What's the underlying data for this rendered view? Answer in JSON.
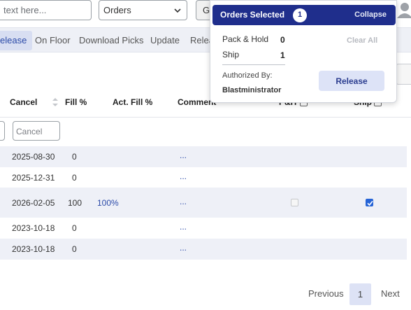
{
  "search": {
    "placeholder": "text here..."
  },
  "orders_select": {
    "value": "Orders"
  },
  "go_button": {
    "label": "G"
  },
  "tabs": [
    {
      "label": "elease",
      "active": true
    },
    {
      "label": "On Floor",
      "active": false
    },
    {
      "label": "Download Picks",
      "active": false
    },
    {
      "label": "Update",
      "active": false
    },
    {
      "label": "Relea",
      "active": false
    }
  ],
  "table": {
    "headers": {
      "cancel": "Cancel",
      "fill_pct": "Fill %",
      "act_fill_pct": "Act. Fill %",
      "comment": "Comment",
      "ph": "P&H",
      "ship": "Ship"
    },
    "filters": {
      "cancel_placeholder": "Cancel"
    },
    "rows": [
      {
        "cancel": "2025-08-30",
        "fill": "0",
        "act_fill": "",
        "comment": "...",
        "ph_checkbox": false,
        "ship_checkbox": false
      },
      {
        "cancel": "2025-12-31",
        "fill": "0",
        "act_fill": "",
        "comment": "...",
        "ph_checkbox": false,
        "ship_checkbox": false
      },
      {
        "cancel": "2026-02-05",
        "fill": "100",
        "act_fill": "100%",
        "comment": "...",
        "ph_checkbox": "disabled",
        "ship_checkbox": true
      },
      {
        "cancel": "2023-10-18",
        "fill": "0",
        "act_fill": "",
        "comment": "...",
        "ph_checkbox": false,
        "ship_checkbox": false
      },
      {
        "cancel": "2023-10-18",
        "fill": "0",
        "act_fill": "",
        "comment": "...",
        "ph_checkbox": false,
        "ship_checkbox": false
      }
    ]
  },
  "pagination": {
    "previous": "Previous",
    "current": "1",
    "next": "Next"
  },
  "popover": {
    "title": "Orders Selected",
    "count": "1",
    "collapse": "Collapse",
    "pack_hold_label": "Pack & Hold",
    "pack_hold_value": "0",
    "ship_label": "Ship",
    "ship_value": "1",
    "clear_all": "Clear All",
    "authorized_label": "Authorized By:",
    "authorized_name": "Blastministrator",
    "release": "Release"
  },
  "colors": {
    "primary": "#1f2e8c",
    "accent": "#2563d6",
    "tab_bg": "#eef0f6"
  },
  "icons": {
    "select_chevron": "chevron-down-icon",
    "sort": "sort-arrows-icon",
    "user": "user-avatar-icon",
    "checkmark": "checkmark-icon"
  }
}
